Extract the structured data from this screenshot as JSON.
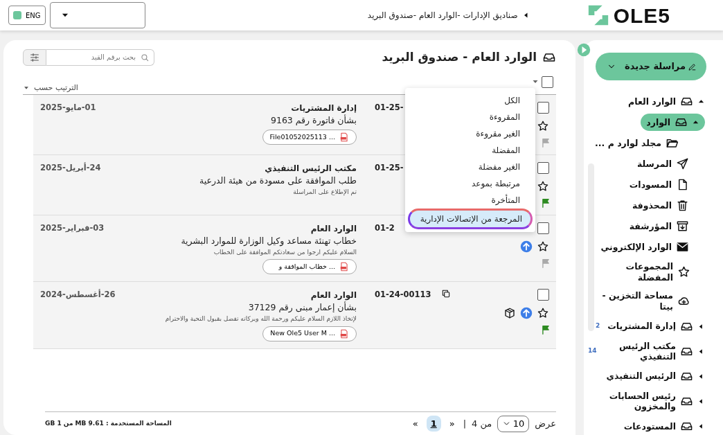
{
  "topbar": {
    "logo": "OLE5",
    "breadcrumb": "صناديق الإدارات -الوارد العام -صندوق البريد",
    "language": "ENG",
    "language_on": true
  },
  "mailbox": {
    "title": "الوارد العام - صندوق البريد",
    "search": {
      "placeholder": "بحث برقم القيد"
    },
    "select_all_checked": false,
    "sort_label": "الترتيب حسب"
  },
  "filter_menu": [
    {
      "label": "الكل",
      "selected": false
    },
    {
      "label": "المقروءة",
      "selected": false
    },
    {
      "label": "الغير مقروءة",
      "selected": false
    },
    {
      "label": "المفضلة",
      "selected": false
    },
    {
      "label": "الغير مفضلة",
      "selected": false
    },
    {
      "label": "مرتبطة بموعد",
      "selected": false
    },
    {
      "label": "المتأخرة",
      "selected": false
    },
    {
      "label": "المرجعة من الإتصالات الإدارية",
      "selected": true
    }
  ],
  "messages": [
    {
      "checked": false,
      "starred": false,
      "flagged": false,
      "package": false,
      "reference": "01-25-",
      "sender": "إدارة المشتريات",
      "subject": "بشأن فاتورة رقم 9163",
      "attachment": "File01052025113 ...",
      "date": "01-مايو-2025"
    },
    {
      "checked": false,
      "starred": false,
      "flagged": true,
      "package": false,
      "reference": "01-25-",
      "sender": "مكتب الرئيس التنفيذي",
      "subject": "طلب الموافقة على مسودة من هيئة الدرعية",
      "preview": "تم الإطلاع على المراسلة",
      "date": "24-أبريل-2025"
    },
    {
      "checked": false,
      "starred": false,
      "flagged": false,
      "forwarded": true,
      "package": false,
      "reference": "01-2",
      "sender": "الوارد العام",
      "subject": "خطاب تهنئة مساعد وكيل الوزارة للموارد البشرية",
      "preview": "السلام عليكم ارجوا من سعادتكم الموافقة على الخطاب",
      "attachment": "خطاب الموافقة و ...",
      "date": "03-فبراير-2025"
    },
    {
      "checked": false,
      "starred": false,
      "flagged": true,
      "forwarded": true,
      "package": true,
      "reference": "01-24-00113",
      "sender": "الوارد العام",
      "subject": "بشأن إعمار مبنى رقم 37129",
      "preview": "لإتخاذ اللازم السلام عليكم ورحمة الله وبركاته تفضل بقبول التحية والاحترام",
      "attachment": "New Ole5 User M ...",
      "date": "26-أغسطس-2024"
    }
  ],
  "pagination": {
    "show_label": "عرض",
    "page_size": "10",
    "of_label": "من 4",
    "separator": "|",
    "prev": "«",
    "pages": [
      {
        "label": "1",
        "selected": true
      }
    ],
    "next": "»"
  },
  "storage": "المساحة المستخدمة : MB 9.61 من GB 1",
  "sidebar": {
    "compose": "مراسلة جديدة",
    "items": [
      {
        "kind": "group",
        "label": "الوارد العام",
        "expanded": true,
        "selected": false,
        "children": [
          {
            "kind": "group",
            "label": "الوارد",
            "expanded": true,
            "selected": true,
            "children": [
              {
                "kind": "folder",
                "label": "مجلد لوارد م ...",
                "selected": false
              }
            ]
          }
        ]
      },
      {
        "kind": "sent",
        "label": "المرسلة",
        "selected": false
      },
      {
        "kind": "draft",
        "label": "المسودات",
        "selected": false
      },
      {
        "kind": "trash",
        "label": "المحذوفة",
        "selected": false
      },
      {
        "kind": "archive",
        "label": "المؤرشفة",
        "selected": false
      },
      {
        "kind": "mail",
        "label": "الوارد الإلكتروني",
        "selected": false
      },
      {
        "kind": "star",
        "label": "المجموعات المفضلة",
        "selected": false
      },
      {
        "kind": "cloud",
        "label": "مساحة التخزين - بيتا",
        "selected": false
      },
      {
        "kind": "group",
        "label": "إدارة المشتريات",
        "count": "2",
        "expanded": false,
        "selected": false
      },
      {
        "kind": "group",
        "label": "مكتب الرئيس التنفيذي",
        "count": "14",
        "expanded": false,
        "selected": false
      },
      {
        "kind": "group",
        "label": "الرئيس التنفيذي",
        "expanded": false,
        "selected": false
      },
      {
        "kind": "group",
        "label": "رئيس الحسابات والمخزون",
        "expanded": false,
        "selected": false
      },
      {
        "kind": "group",
        "label": "المستودعات",
        "expanded": false,
        "selected": false
      }
    ]
  }
}
